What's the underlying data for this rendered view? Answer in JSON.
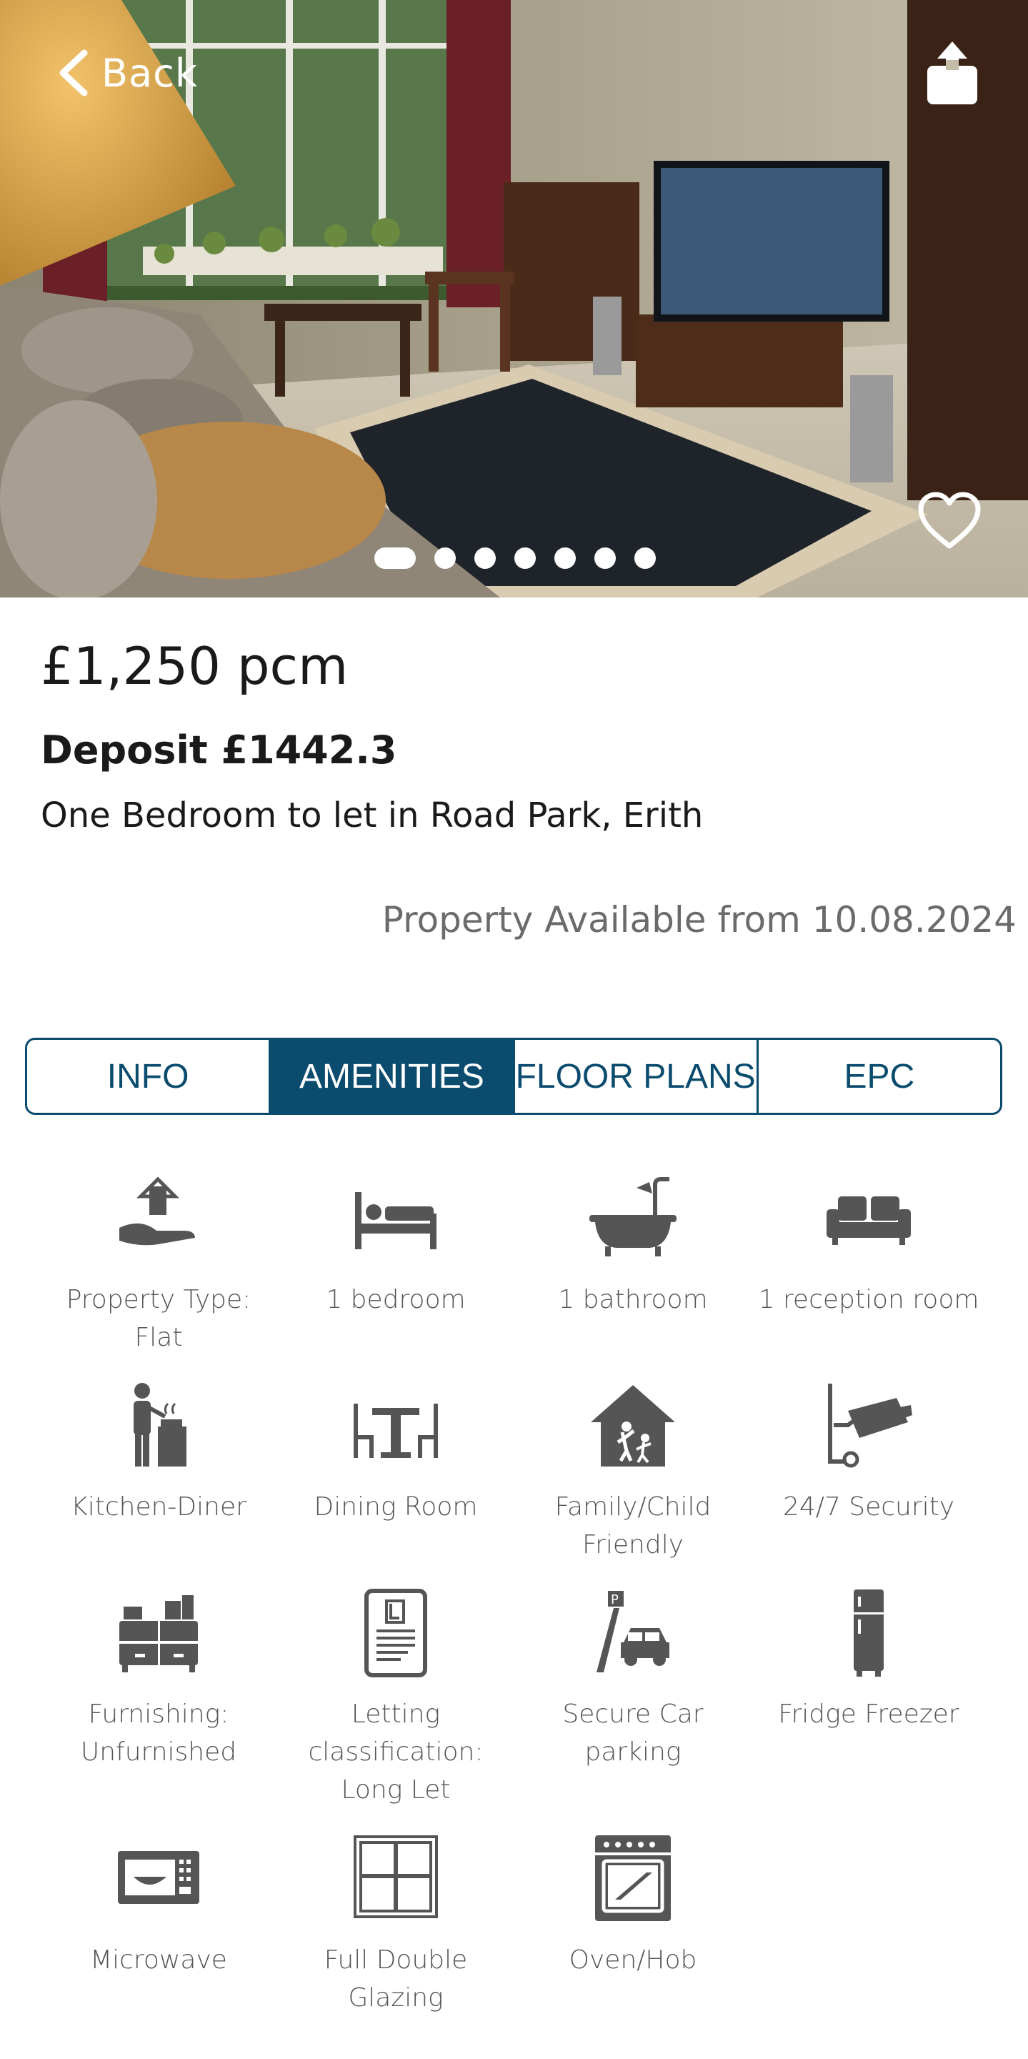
{
  "header": {
    "back_label": "Back",
    "carousel": {
      "count": 7,
      "active_index": 0
    }
  },
  "listing": {
    "price": "£1,250 pcm",
    "deposit": "Deposit £1442.3",
    "title": "One Bedroom to let in Road Park, Erith",
    "availability": "Property Available from 10.08.2024"
  },
  "tabs": [
    {
      "label": "INFO",
      "active": false
    },
    {
      "label": "AMENITIES",
      "active": true
    },
    {
      "label": "FLOOR PLANS",
      "active": false
    },
    {
      "label": "EPC",
      "active": false
    }
  ],
  "amenities": [
    {
      "icon": "property-type-icon",
      "label": "Property Type: Flat"
    },
    {
      "icon": "bed-icon",
      "label": "1 bedroom"
    },
    {
      "icon": "bathtub-icon",
      "label": "1 bathroom"
    },
    {
      "icon": "sofa-icon",
      "label": "1 reception room"
    },
    {
      "icon": "kitchen-icon",
      "label": "Kitchen-Diner"
    },
    {
      "icon": "dining-table-icon",
      "label": "Dining Room"
    },
    {
      "icon": "family-house-icon",
      "label": "Family/Child Friendly"
    },
    {
      "icon": "security-camera-icon",
      "label": "24/7 Security"
    },
    {
      "icon": "furniture-icon",
      "label": "Furnishing: Unfurnished"
    },
    {
      "icon": "letting-document-icon",
      "label": "Letting classification: Long Let"
    },
    {
      "icon": "car-parking-icon",
      "label": "Secure Car parking"
    },
    {
      "icon": "fridge-icon",
      "label": "Fridge Freezer"
    },
    {
      "icon": "microwave-icon",
      "label": "Microwave"
    },
    {
      "icon": "window-icon",
      "label": "Full Double Glazing"
    },
    {
      "icon": "oven-icon",
      "label": "Oven/Hob"
    }
  ],
  "colors": {
    "accent": "#0a4b6e",
    "icon": "#555555",
    "muted_text": "#6b6b6b"
  }
}
